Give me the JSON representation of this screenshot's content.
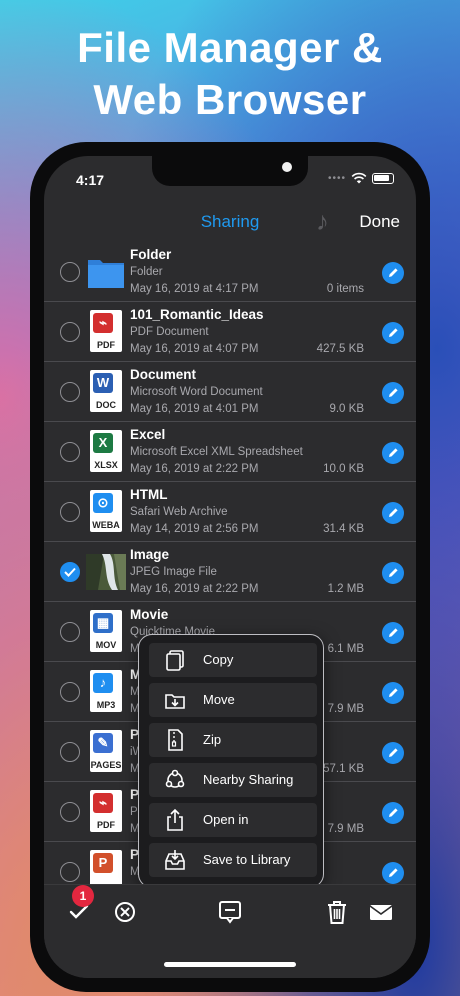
{
  "headline": {
    "line1": "File Manager &",
    "line2": "Web Browser"
  },
  "status_bar": {
    "time": "4:17",
    "more": "••••"
  },
  "nav": {
    "title": "Sharing",
    "done": "Done"
  },
  "files": [
    {
      "name": "Folder",
      "type": "Folder",
      "date": "May 16, 2019 at 4:17 PM",
      "size": "0 items",
      "icon": "folder-icon",
      "checked": false
    },
    {
      "name": "101_Romantic_Ideas",
      "type": "PDF Document",
      "date": "May 16, 2019 at 4:07 PM",
      "size": "427.5 KB",
      "icon": "pdf-icon",
      "label": "PDF",
      "checked": false
    },
    {
      "name": "Document",
      "type": "Microsoft Word Document",
      "date": "May 16, 2019 at 4:01 PM",
      "size": "9.0 KB",
      "icon": "word-icon",
      "label": "DOC",
      "checked": false
    },
    {
      "name": "Excel",
      "type": "Microsoft Excel XML Spreadsheet",
      "date": "May 16, 2019 at 2:22 PM",
      "size": "10.0 KB",
      "icon": "excel-icon",
      "label": "XLSX",
      "checked": false
    },
    {
      "name": "HTML",
      "type": "Safari Web Archive",
      "date": "May 14, 2019 at 2:56 PM",
      "size": "31.4 KB",
      "icon": "safari-icon",
      "label": "WEBA",
      "checked": false
    },
    {
      "name": "Image",
      "type": "JPEG Image File",
      "date": "May 16, 2019 at 2:22 PM",
      "size": "1.2 MB",
      "icon": "image-thumbnail",
      "checked": true
    },
    {
      "name": "Movie",
      "type": "Quicktime Movie",
      "date": "Ma",
      "size": "6.1 MB",
      "icon": "movie-icon",
      "label": "MOV",
      "checked": false
    },
    {
      "name": "Mu",
      "type": "MP",
      "date": "Ma",
      "size": "7.9 MB",
      "icon": "music-icon",
      "label": "MP3",
      "checked": false
    },
    {
      "name": "Pa",
      "type": "iWork Pages Document",
      "date": "Ma",
      "size": "57.1 KB",
      "icon": "pages-icon",
      "label": "PAGES",
      "checked": false
    },
    {
      "name": "PD",
      "type": "PD",
      "date": "Ma",
      "size": "7.9 MB",
      "icon": "pdf-icon",
      "label": "PDF",
      "checked": false
    },
    {
      "name": "Pr",
      "type": "MS",
      "date": "",
      "size": "",
      "icon": "powerpoint-icon",
      "label": "",
      "checked": false
    }
  ],
  "menu": [
    {
      "label": "Copy",
      "icon": "copy-icon"
    },
    {
      "label": "Move",
      "icon": "move-icon"
    },
    {
      "label": "Zip",
      "icon": "zip-icon"
    },
    {
      "label": "Nearby Sharing",
      "icon": "nearby-sharing-icon"
    },
    {
      "label": "Open in",
      "icon": "open-in-icon"
    },
    {
      "label": "Save to Library",
      "icon": "save-to-library-icon"
    }
  ],
  "toolbar": {
    "badge": "1"
  },
  "colors": {
    "accent": "#1f8ef0",
    "background": "#2c2c2e",
    "badge": "#e3273f"
  }
}
